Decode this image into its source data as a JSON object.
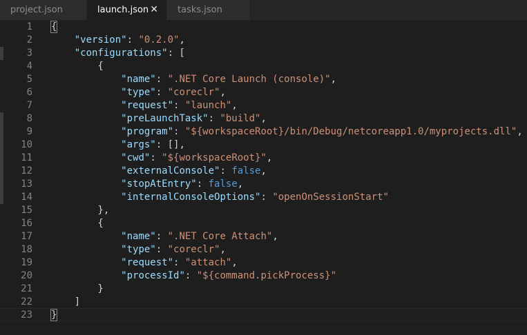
{
  "tabs": [
    {
      "label": "project.json",
      "active": false
    },
    {
      "label": "launch.json",
      "active": true,
      "close_icon": "close-icon",
      "close_glyph": "✕"
    },
    {
      "label": "tasks.json",
      "active": false
    }
  ],
  "editor": {
    "lines": [
      {
        "num": "1",
        "tokens": [
          {
            "t": "p",
            "v": "{"
          }
        ]
      },
      {
        "num": "2",
        "tokens": [
          {
            "t": "p",
            "v": "    "
          },
          {
            "t": "k",
            "v": "\"version\""
          },
          {
            "t": "p",
            "v": ": "
          },
          {
            "t": "s",
            "v": "\"0.2.0\""
          },
          {
            "t": "p",
            "v": ","
          }
        ]
      },
      {
        "num": "3",
        "tokens": [
          {
            "t": "p",
            "v": "    "
          },
          {
            "t": "k",
            "v": "\"configurations\""
          },
          {
            "t": "p",
            "v": ": ["
          }
        ]
      },
      {
        "num": "4",
        "tokens": [
          {
            "t": "p",
            "v": "        {"
          }
        ]
      },
      {
        "num": "5",
        "tokens": [
          {
            "t": "p",
            "v": "            "
          },
          {
            "t": "k",
            "v": "\"name\""
          },
          {
            "t": "p",
            "v": ": "
          },
          {
            "t": "s",
            "v": "\".NET Core Launch (console)\""
          },
          {
            "t": "p",
            "v": ","
          }
        ]
      },
      {
        "num": "6",
        "tokens": [
          {
            "t": "p",
            "v": "            "
          },
          {
            "t": "k",
            "v": "\"type\""
          },
          {
            "t": "p",
            "v": ": "
          },
          {
            "t": "s",
            "v": "\"coreclr\""
          },
          {
            "t": "p",
            "v": ","
          }
        ]
      },
      {
        "num": "7",
        "tokens": [
          {
            "t": "p",
            "v": "            "
          },
          {
            "t": "k",
            "v": "\"request\""
          },
          {
            "t": "p",
            "v": ": "
          },
          {
            "t": "s",
            "v": "\"launch\""
          },
          {
            "t": "p",
            "v": ","
          }
        ]
      },
      {
        "num": "8",
        "tokens": [
          {
            "t": "p",
            "v": "            "
          },
          {
            "t": "k",
            "v": "\"preLaunchTask\""
          },
          {
            "t": "p",
            "v": ": "
          },
          {
            "t": "s",
            "v": "\"build\""
          },
          {
            "t": "p",
            "v": ","
          }
        ]
      },
      {
        "num": "9",
        "tokens": [
          {
            "t": "p",
            "v": "            "
          },
          {
            "t": "k",
            "v": "\"program\""
          },
          {
            "t": "p",
            "v": ": "
          },
          {
            "t": "s",
            "v": "\"${workspaceRoot}/bin/Debug/netcoreapp1.0/myprojects.dll\""
          },
          {
            "t": "p",
            "v": ","
          }
        ]
      },
      {
        "num": "10",
        "tokens": [
          {
            "t": "p",
            "v": "            "
          },
          {
            "t": "k",
            "v": "\"args\""
          },
          {
            "t": "p",
            "v": ": [],"
          }
        ]
      },
      {
        "num": "11",
        "tokens": [
          {
            "t": "p",
            "v": "            "
          },
          {
            "t": "k",
            "v": "\"cwd\""
          },
          {
            "t": "p",
            "v": ": "
          },
          {
            "t": "s",
            "v": "\"${workspaceRoot}\""
          },
          {
            "t": "p",
            "v": ","
          }
        ]
      },
      {
        "num": "12",
        "tokens": [
          {
            "t": "p",
            "v": "            "
          },
          {
            "t": "k",
            "v": "\"externalConsole\""
          },
          {
            "t": "p",
            "v": ": "
          },
          {
            "t": "b",
            "v": "false"
          },
          {
            "t": "p",
            "v": ","
          }
        ]
      },
      {
        "num": "13",
        "tokens": [
          {
            "t": "p",
            "v": "            "
          },
          {
            "t": "k",
            "v": "\"stopAtEntry\""
          },
          {
            "t": "p",
            "v": ": "
          },
          {
            "t": "b",
            "v": "false"
          },
          {
            "t": "p",
            "v": ","
          }
        ]
      },
      {
        "num": "14",
        "tokens": [
          {
            "t": "p",
            "v": "            "
          },
          {
            "t": "k",
            "v": "\"internalConsoleOptions\""
          },
          {
            "t": "p",
            "v": ": "
          },
          {
            "t": "s",
            "v": "\"openOnSessionStart\""
          }
        ]
      },
      {
        "num": "15",
        "tokens": [
          {
            "t": "p",
            "v": "        },"
          }
        ]
      },
      {
        "num": "16",
        "tokens": [
          {
            "t": "p",
            "v": "        {"
          }
        ]
      },
      {
        "num": "17",
        "tokens": [
          {
            "t": "p",
            "v": "            "
          },
          {
            "t": "k",
            "v": "\"name\""
          },
          {
            "t": "p",
            "v": ": "
          },
          {
            "t": "s",
            "v": "\".NET Core Attach\""
          },
          {
            "t": "p",
            "v": ","
          }
        ]
      },
      {
        "num": "18",
        "tokens": [
          {
            "t": "p",
            "v": "            "
          },
          {
            "t": "k",
            "v": "\"type\""
          },
          {
            "t": "p",
            "v": ": "
          },
          {
            "t": "s",
            "v": "\"coreclr\""
          },
          {
            "t": "p",
            "v": ","
          }
        ]
      },
      {
        "num": "19",
        "tokens": [
          {
            "t": "p",
            "v": "            "
          },
          {
            "t": "k",
            "v": "\"request\""
          },
          {
            "t": "p",
            "v": ": "
          },
          {
            "t": "s",
            "v": "\"attach\""
          },
          {
            "t": "p",
            "v": ","
          }
        ]
      },
      {
        "num": "20",
        "tokens": [
          {
            "t": "p",
            "v": "            "
          },
          {
            "t": "k",
            "v": "\"processId\""
          },
          {
            "t": "p",
            "v": ": "
          },
          {
            "t": "s",
            "v": "\"${command.pickProcess}\""
          }
        ]
      },
      {
        "num": "21",
        "tokens": [
          {
            "t": "p",
            "v": "        }"
          }
        ]
      },
      {
        "num": "22",
        "tokens": [
          {
            "t": "p",
            "v": "    ]"
          }
        ]
      },
      {
        "num": "23",
        "tokens": [
          {
            "t": "p",
            "v": "}"
          }
        ]
      }
    ],
    "active_line": "23",
    "gutter_marked_lines": [
      "3",
      "8",
      "9",
      "10",
      "11",
      "12",
      "13",
      "14"
    ]
  },
  "colors": {
    "background": "#1e1e1e",
    "tabbar": "#252526",
    "key": "#9cdcfe",
    "string": "#ce9178",
    "boolean": "#569cd6",
    "punctuation": "#d4d4d4",
    "line_number": "#858585"
  }
}
